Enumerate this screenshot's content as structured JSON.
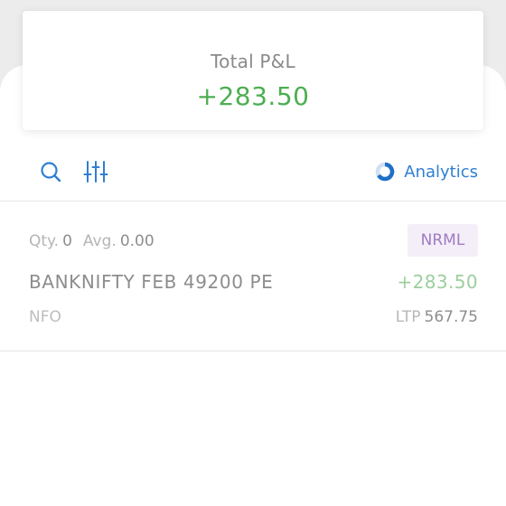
{
  "summary": {
    "label": "Total P&L",
    "value": "+283.50"
  },
  "toolbar": {
    "search_icon": "search-icon",
    "filter_icon": "sliders-icon",
    "analytics_icon": "analytics-ring-icon",
    "analytics_label": "Analytics"
  },
  "positions": [
    {
      "qty_label": "Qty.",
      "qty": "0",
      "avg_label": "Avg.",
      "avg": "0.00",
      "product": "NRML",
      "symbol": "BANKNIFTY FEB 49200 PE",
      "pnl": "+283.50",
      "exchange": "NFO",
      "ltp_label": "LTP",
      "ltp": "567.75"
    }
  ],
  "colors": {
    "profit": "#4caf50",
    "profit_muted": "#9ccf9e",
    "accent": "#2f7fd1",
    "badge_text": "#a07cc3",
    "badge_bg": "#f4eef8"
  }
}
